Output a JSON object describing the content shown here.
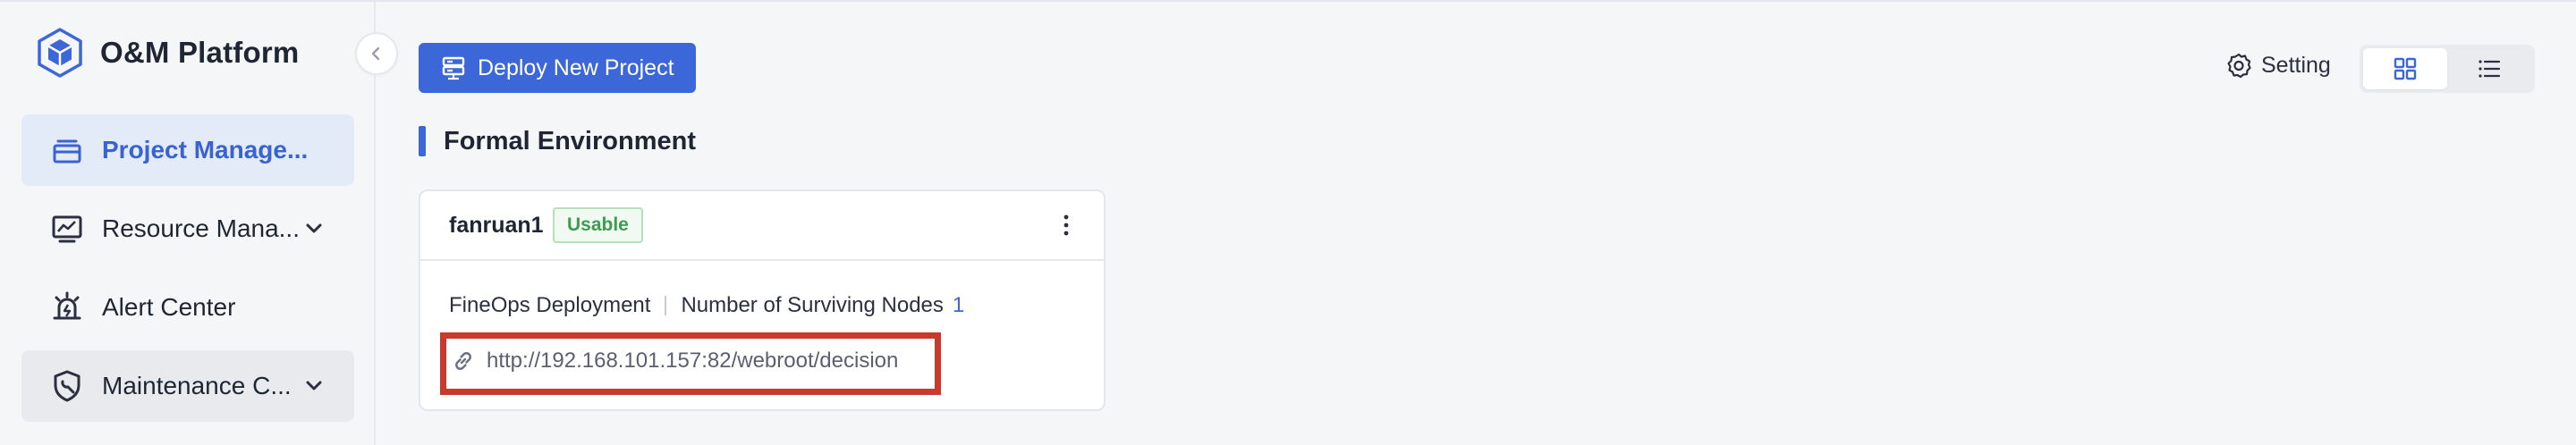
{
  "app": {
    "title": "O&M Platform"
  },
  "sidebar": {
    "items": [
      {
        "label": "Project Manage...",
        "icon": "layers-icon",
        "active": true
      },
      {
        "label": "Resource Mana...",
        "icon": "monitor-chart-icon",
        "expandable": true
      },
      {
        "label": "Alert Center",
        "icon": "alarm-icon"
      },
      {
        "label": "Maintenance C...",
        "icon": "shield-wrench-icon",
        "expandable": true
      }
    ]
  },
  "toolbar": {
    "deploy_label": "Deploy New Project",
    "setting_label": "Setting",
    "view_modes": [
      "grid",
      "list"
    ],
    "selected_view": "grid"
  },
  "section": {
    "title": "Formal Environment"
  },
  "project": {
    "name": "fanruan1",
    "status": "Usable",
    "deployment_type": "FineOps Deployment",
    "nodes_label": "Number of Surviving Nodes",
    "nodes_count": "1",
    "url": "http://192.168.101.157:82/webroot/decision"
  },
  "colors": {
    "accent": "#3c67d8",
    "status_green": "#3e9b4f",
    "highlight_red": "#c93a2c",
    "active_nav_bg": "#e4ebf8"
  }
}
